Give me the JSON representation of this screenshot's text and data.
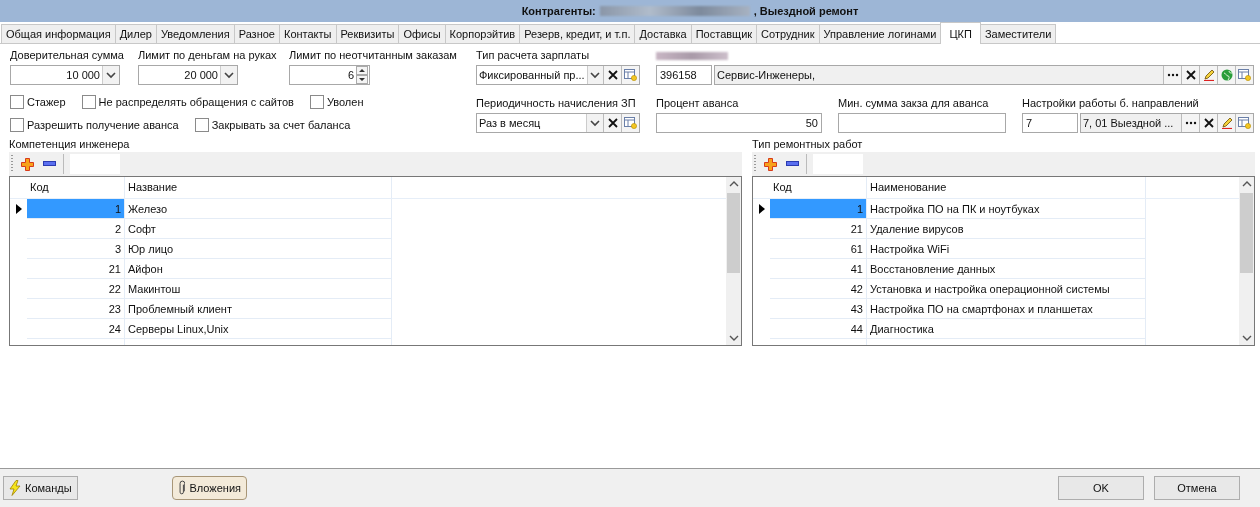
{
  "window": {
    "title_prefix": "Контрагенты:",
    "title_suffix": ", Выездной ремонт"
  },
  "tabs": [
    {
      "label": "Общая информация",
      "selected": false
    },
    {
      "label": "Дилер",
      "selected": false
    },
    {
      "label": "Уведомления",
      "selected": false
    },
    {
      "label": "Разное",
      "selected": false
    },
    {
      "label": "Контакты",
      "selected": false
    },
    {
      "label": "Реквизиты",
      "selected": false
    },
    {
      "label": "Офисы",
      "selected": false
    },
    {
      "label": "Корпорэйтив",
      "selected": false
    },
    {
      "label": "Резерв, кредит, и т.п.",
      "selected": false
    },
    {
      "label": "Доставка",
      "selected": false
    },
    {
      "label": "Поставщик",
      "selected": false
    },
    {
      "label": "Сотрудник",
      "selected": false
    },
    {
      "label": "Управление логинами",
      "selected": false
    },
    {
      "label": "ЦКП",
      "selected": true
    },
    {
      "label": "Заместители",
      "selected": false
    }
  ],
  "limits": [
    {
      "label": "Доверительная сумма",
      "value": "10 000",
      "kind": "combo"
    },
    {
      "label": "Лимит по деньгам на руках",
      "value": "20 000",
      "kind": "combo"
    },
    {
      "label": "Лимит по неотчитанным заказам",
      "value": "6",
      "kind": "spin"
    }
  ],
  "checkbox_rows": [
    [
      {
        "label": "Стажер",
        "checked": false
      },
      {
        "label": "Не распределять обращения с сайтов",
        "checked": false
      },
      {
        "label": "Уволен",
        "checked": false
      }
    ],
    [
      {
        "label": "Разрешить получение аванса",
        "checked": false
      },
      {
        "label": "Закрывать за счет баланса",
        "checked": false
      }
    ]
  ],
  "salary_type": {
    "label": "Тип расчета зарплаты",
    "value": "Фиксированный пр..."
  },
  "counterparty": {
    "code": "396158",
    "name": "Сервис-Инженеры,"
  },
  "pay_period": {
    "label": "Периодичность начисления ЗП",
    "value": "Раз в месяц"
  },
  "advance_percent": {
    "label": "Процент аванса",
    "value": "50"
  },
  "min_advance_sum": {
    "label": "Мин. сумма закза для аванса"
  },
  "direction_settings": {
    "label": "Настройки работы б. направлений",
    "code": "7",
    "name": "7, 01 Выездной ..."
  },
  "grids": [
    {
      "title": "Компетенция инженера",
      "columns": [
        "Код",
        "Название"
      ],
      "rows": [
        {
          "code": "1",
          "name": "Железо",
          "selected": true
        },
        {
          "code": "2",
          "name": "Софт",
          "selected": false
        },
        {
          "code": "3",
          "name": "Юр лицо",
          "selected": false
        },
        {
          "code": "21",
          "name": "Айфон",
          "selected": false
        },
        {
          "code": "22",
          "name": "Макинтош",
          "selected": false
        },
        {
          "code": "23",
          "name": "Проблемный клиент",
          "selected": false
        },
        {
          "code": "24",
          "name": "Серверы Linux,Unix",
          "selected": false
        }
      ]
    },
    {
      "title": "Тип ремонтных работ",
      "columns": [
        "Код",
        "Наименование"
      ],
      "rows": [
        {
          "code": "1",
          "name": "Настройка ПО на ПК и ноутбуках",
          "selected": true
        },
        {
          "code": "21",
          "name": "Удаление вирусов",
          "selected": false
        },
        {
          "code": "61",
          "name": "Настройка WiFi",
          "selected": false
        },
        {
          "code": "41",
          "name": "Восстановление данных",
          "selected": false
        },
        {
          "code": "42",
          "name": "Установка и настройка операционной системы",
          "selected": false
        },
        {
          "code": "43",
          "name": "Настройка ПО на смартфонах и планшетах",
          "selected": false
        },
        {
          "code": "44",
          "name": "Диагностика",
          "selected": false
        }
      ]
    }
  ],
  "footer": {
    "commands": "Команды",
    "attachments": "Вложения",
    "ok": "OK",
    "cancel": "Отмена"
  }
}
